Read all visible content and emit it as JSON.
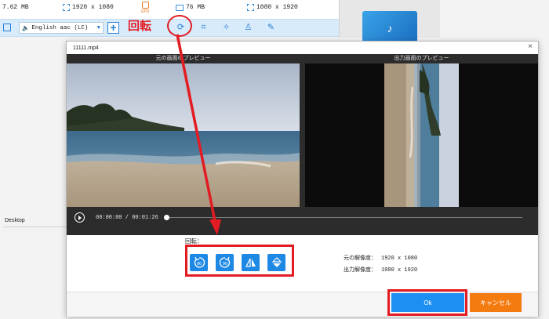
{
  "background_app": {
    "info_size_left": "7.62 MB",
    "info_res_left": "1920 x 1080",
    "info_gpu": "GPU",
    "info_size_right": "76 MB",
    "info_res_right": "1080 x 1920",
    "audio_track": "English aac (LC)",
    "add_label": "+",
    "rotate_annotation": "回転",
    "sidebar_location": "Desktop"
  },
  "dialog": {
    "title": "11111.mp4",
    "close_label": "×",
    "original_preview_label": "元の画面のプレビュー",
    "output_preview_label": "出力画面のプレビュー",
    "time_display": "00:00:00 / 00:01:26",
    "progress": 0,
    "rotate_label": "回転：",
    "rotate_buttons": [
      "rotate-left-90",
      "rotate-right-90",
      "flip-horizontal",
      "flip-vertical"
    ],
    "original_resolution_label": "元の解像度：",
    "original_resolution_value": "1920 x 1080",
    "output_resolution_label": "出力解像度：",
    "output_resolution_value": "1080 x 1920",
    "ok_label": "Ok",
    "cancel_label": "キャンセル"
  },
  "colors": {
    "accent_blue": "#1d8ff2",
    "annotation_red": "#e31b23",
    "cancel_orange": "#f47b10"
  }
}
